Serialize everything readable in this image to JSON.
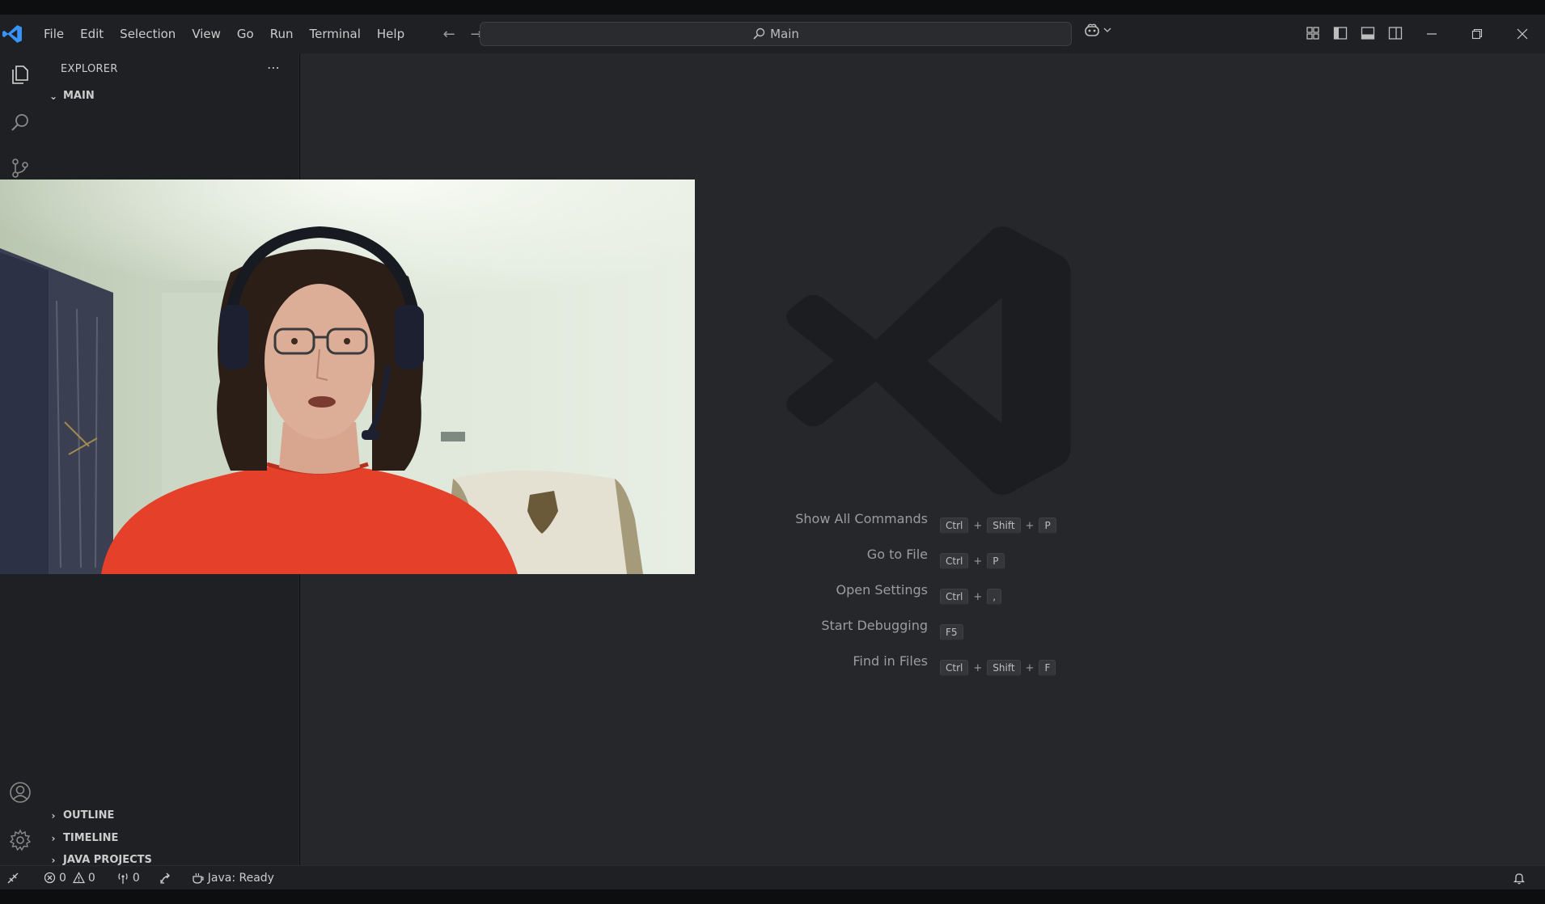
{
  "window": {
    "title": "Main"
  },
  "menu": [
    "File",
    "Edit",
    "Selection",
    "View",
    "Go",
    "Run",
    "Terminal",
    "Help"
  ],
  "sidebar": {
    "header": "EXPLORER",
    "folder": "MAIN",
    "sections": [
      "OUTLINE",
      "TIMELINE",
      "JAVA PROJECTS"
    ]
  },
  "shortcuts": [
    {
      "label": "Show All Commands",
      "keys": [
        "Ctrl",
        "Shift",
        "P"
      ]
    },
    {
      "label": "Go to File",
      "keys": [
        "Ctrl",
        "P"
      ]
    },
    {
      "label": "Open Settings",
      "keys": [
        "Ctrl",
        ","
      ]
    },
    {
      "label": "Start Debugging",
      "keys": [
        "F5"
      ]
    },
    {
      "label": "Find in Files",
      "keys": [
        "Ctrl",
        "Shift",
        "F"
      ]
    }
  ],
  "statusbar": {
    "errors": "0",
    "warnings": "0",
    "ports": "0",
    "java": "Java: Ready"
  },
  "colors": {
    "accent": "#3794ff",
    "editor_bg": "#26272b",
    "chrome_bg": "#1f2023"
  }
}
